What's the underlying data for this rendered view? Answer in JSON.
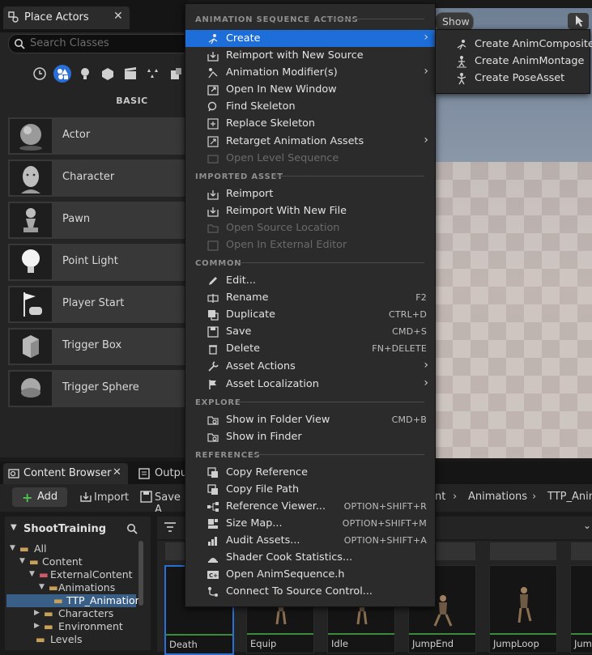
{
  "place_actors": {
    "tab_label": "Place Actors",
    "search_placeholder": "Search Classes",
    "category_label": "BASIC",
    "actors": [
      "Actor",
      "Character",
      "Pawn",
      "Point Light",
      "Player Start",
      "Trigger Box",
      "Trigger Sphere"
    ]
  },
  "viewport": {
    "show_label": "Show"
  },
  "context_menu": {
    "sections": {
      "anim_actions": "ANIMATION SEQUENCE ACTIONS",
      "imported_asset": "IMPORTED ASSET",
      "common": "COMMON",
      "explore": "EXPLORE",
      "references": "REFERENCES"
    },
    "anim_items": [
      "Create",
      "Reimport with New Source",
      "Animation Modifier(s)",
      "Open In New Window",
      "Find Skeleton",
      "Replace Skeleton",
      "Retarget Animation Assets",
      "Open Level Sequence"
    ],
    "imported_items": [
      "Reimport",
      "Reimport With New File",
      "Open Source Location",
      "Open In External Editor"
    ],
    "common_items": [
      "Edit...",
      "Rename",
      "Duplicate",
      "Save",
      "Delete",
      "Asset Actions",
      "Asset Localization"
    ],
    "common_shortcuts": {
      "rename": "F2",
      "duplicate": "CTRL+D",
      "save": "CMD+S",
      "delete": "FN+DELETE"
    },
    "explore_items": [
      "Show in Folder View",
      "Show in Finder"
    ],
    "explore_shortcuts": {
      "folder_view": "CMD+B"
    },
    "reference_items": [
      "Copy Reference",
      "Copy File Path",
      "Reference Viewer...",
      "Size Map...",
      "Audit Assets...",
      "Shader Cook Statistics...",
      "Open AnimSequence.h",
      "Connect To Source Control..."
    ],
    "reference_shortcuts": {
      "ref_viewer": "OPTION+SHIFT+R",
      "size_map": "OPTION+SHIFT+M",
      "audit": "OPTION+SHIFT+A"
    }
  },
  "create_submenu": [
    "Create AnimComposite",
    "Create AnimMontage",
    "Create PoseAsset"
  ],
  "content_browser": {
    "tab_label": "Content Browser",
    "output_tab_label": "Output",
    "add_label": "Add",
    "import_label": "Import",
    "save_all_label": "Save A",
    "breadcrumb": [
      "nt",
      "Animations",
      "TTP_Anim"
    ],
    "tree_root": "ShootTraining",
    "tree": [
      "All",
      "Content",
      "ExternalContent",
      "Animations",
      "TTP_Animation",
      "Characters",
      "Environment",
      "Levels"
    ],
    "assets": [
      "Death",
      "Equip",
      "Idle",
      "JumpEnd",
      "JumpLoop",
      "Jum"
    ]
  }
}
